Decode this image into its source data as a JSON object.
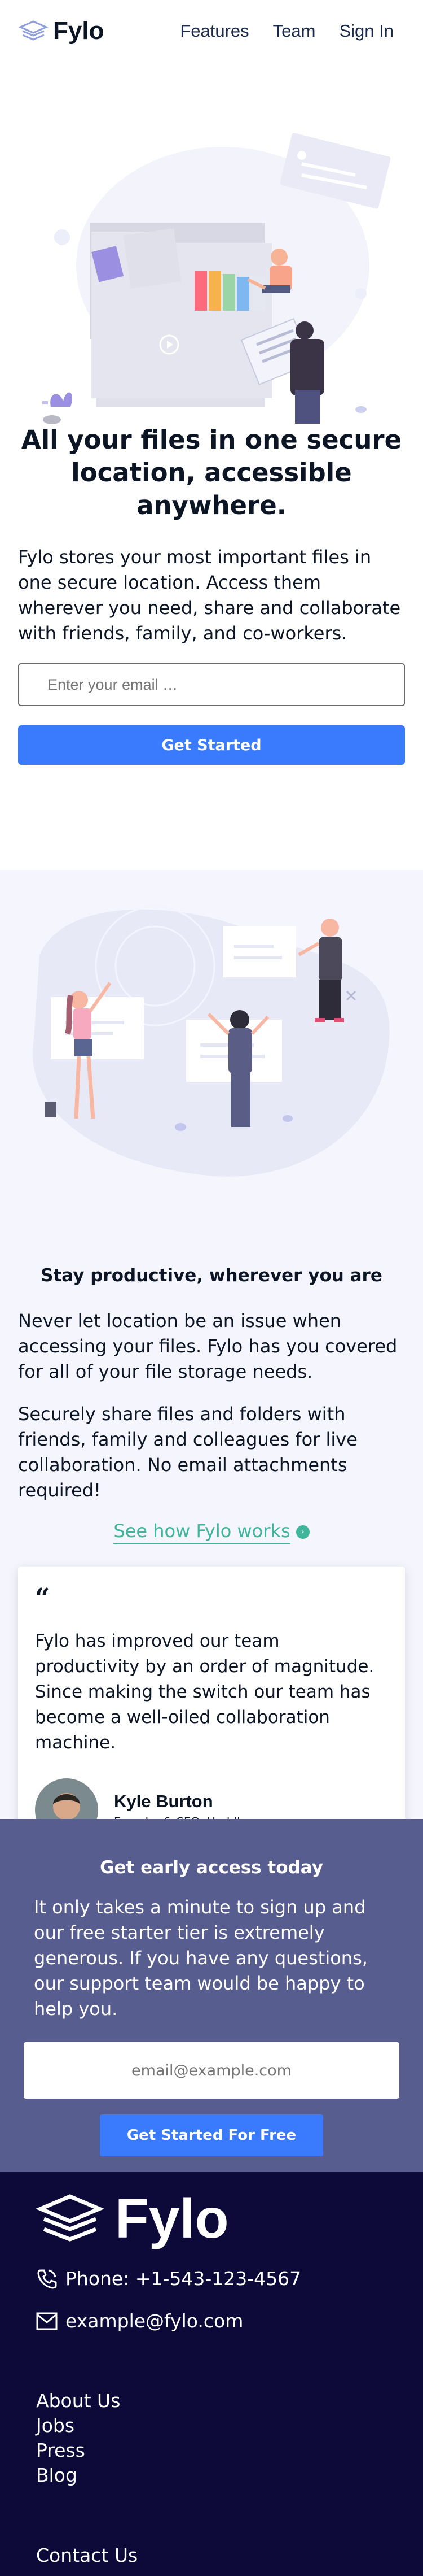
{
  "brand": {
    "name": "Fylo"
  },
  "nav": {
    "items": [
      "Features",
      "Team",
      "Sign In"
    ]
  },
  "hero": {
    "title": "All your files in one secure location, accessible anywhere.",
    "text": "Fylo stores your most important files in one secure location. Access them wherever you need, share and collaborate with friends, family, and co-workers.",
    "email_placeholder": "Enter your email …",
    "cta_label": "Get Started"
  },
  "productive": {
    "title": "Stay productive, wherever you are",
    "text1": "Never let location be an issue when accessing your files. Fylo has you covered for all of your file storage needs.",
    "text2": "Securely share files and folders with friends, family and colleagues for live collaboration. No email attachments required!",
    "link_label": "See how Fylo works"
  },
  "testimonial": {
    "quote_mark": "“",
    "quote": "Fylo has improved our team productivity by an order of magnitude. Since making the switch our team has become a well-oiled collaboration machine.",
    "name": "Kyle Burton",
    "role": "Founder & CEO, Huddle"
  },
  "early_access": {
    "title": "Get early access today",
    "text": "It only takes a minute to sign up and our free starter tier is extremely generous. If you have any questions, our support team would be happy to help you.",
    "email_placeholder": "email@example.com",
    "cta_label": "Get Started For Free"
  },
  "footer": {
    "phone": "Phone: +1-543-123-4567",
    "email": "example@fylo.com",
    "links": [
      "About Us",
      "Jobs",
      "Press",
      "Blog"
    ],
    "contact_label": "Contact Us"
  },
  "colors": {
    "accent": "#3a7bfd",
    "teal": "#3fb59b",
    "early_bg": "#585d8f",
    "footer_bg": "#0d0a3a",
    "section_bg": "#f4f5fd"
  },
  "icons": [
    "logo-layers-icon",
    "phone-icon",
    "email-icon",
    "arrow-right-icon",
    "quote-icon"
  ]
}
